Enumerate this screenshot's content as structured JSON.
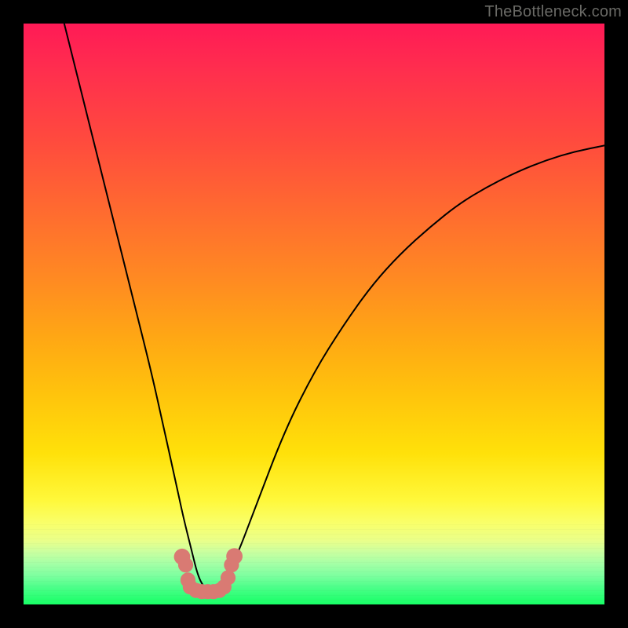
{
  "watermark": {
    "text": "TheBottleneck.com"
  },
  "chart_data": {
    "type": "line",
    "title": "",
    "xlabel": "",
    "ylabel": "",
    "xlim": [
      0,
      100
    ],
    "ylim": [
      0,
      100
    ],
    "grid": false,
    "legend": false,
    "annotations": [],
    "series": [
      {
        "name": "curve",
        "x": [
          7,
          10,
          13,
          16,
          19,
          22,
          24,
          26,
          27.5,
          29,
          30,
          31,
          32,
          33.5,
          35,
          37,
          40,
          45,
          50,
          55,
          60,
          65,
          70,
          75,
          80,
          85,
          90,
          95,
          100
        ],
        "values": [
          100,
          88,
          76,
          64,
          52,
          40,
          31,
          22,
          15,
          9,
          5,
          3,
          2.5,
          3,
          5,
          9,
          17,
          30,
          40,
          48,
          55,
          60.5,
          65,
          69,
          72,
          74.5,
          76.5,
          78,
          79
        ]
      }
    ],
    "markers": {
      "name": "minimum-highlight",
      "color": "#d97a73",
      "points": [
        {
          "x": 27.3,
          "y": 8.2,
          "r": 1.4
        },
        {
          "x": 27.9,
          "y": 6.8,
          "r": 1.3
        },
        {
          "x": 28.3,
          "y": 4.2,
          "r": 1.3
        },
        {
          "x": 28.7,
          "y": 3.0,
          "r": 1.3
        },
        {
          "x": 29.7,
          "y": 2.4,
          "r": 1.3
        },
        {
          "x": 30.7,
          "y": 2.2,
          "r": 1.3
        },
        {
          "x": 31.7,
          "y": 2.2,
          "r": 1.3
        },
        {
          "x": 32.7,
          "y": 2.2,
          "r": 1.3
        },
        {
          "x": 33.7,
          "y": 2.4,
          "r": 1.3
        },
        {
          "x": 34.5,
          "y": 3.0,
          "r": 1.3
        },
        {
          "x": 35.2,
          "y": 4.6,
          "r": 1.3
        },
        {
          "x": 35.8,
          "y": 6.8,
          "r": 1.3
        },
        {
          "x": 36.3,
          "y": 8.3,
          "r": 1.4
        }
      ]
    },
    "background_gradient": {
      "stops": [
        {
          "pos": 0,
          "color": "#ff1a56"
        },
        {
          "pos": 20,
          "color": "#ff4a3e"
        },
        {
          "pos": 44,
          "color": "#ff8a22"
        },
        {
          "pos": 64,
          "color": "#ffc40c"
        },
        {
          "pos": 82,
          "color": "#fff83a"
        },
        {
          "pos": 91,
          "color": "#c9ffa0"
        },
        {
          "pos": 100,
          "color": "#18ff66"
        }
      ]
    }
  }
}
